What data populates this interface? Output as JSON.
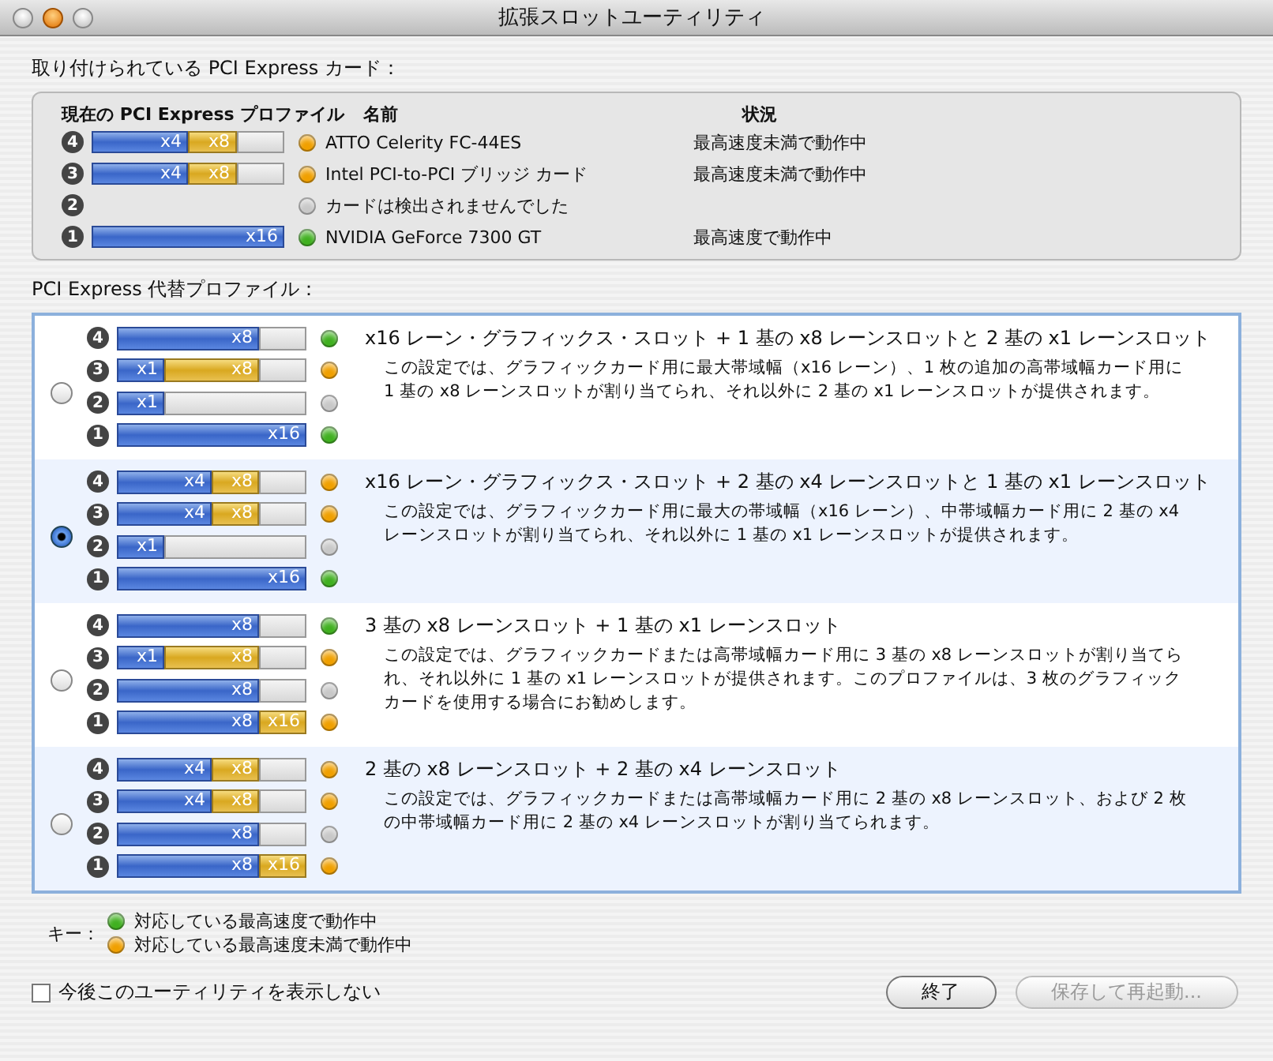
{
  "window": {
    "title": "拡張スロットユーティリティ"
  },
  "installed": {
    "heading": "取り付けられている PCI Express カード：",
    "columns": [
      "現在の PCI Express プロファイル",
      "名前",
      "状況"
    ],
    "rows": [
      {
        "slot": "4",
        "segments": [
          {
            "kind": "link_half",
            "label": "x4"
          },
          {
            "kind": "card_quarter",
            "label": "x8"
          },
          {
            "kind": "spare_quarter"
          }
        ],
        "color": "#f0a000",
        "name": "ATTO Celerity FC-44ES",
        "status": "最高速度未満で動作中"
      },
      {
        "slot": "3",
        "segments": [
          {
            "kind": "link_half",
            "label": "x4"
          },
          {
            "kind": "card_quarter",
            "label": "x8"
          },
          {
            "kind": "spare_quarter"
          }
        ],
        "color": "#f0a000",
        "name": "Intel PCI-to-PCI ブリッジ カード",
        "status": "最高速度未満で動作中"
      },
      {
        "slot": "2",
        "segments": [],
        "color": "#c8c8c8",
        "name": "カードは検出されませんでした"
      },
      {
        "slot": "1",
        "segments": [
          {
            "kind": "link_whole",
            "label": "x16"
          }
        ],
        "color": "#40b020",
        "name": "NVIDIA GeForce 7300 GT",
        "status": "最高速度で動作中"
      }
    ]
  },
  "profiles": {
    "heading": "PCI Express 代替プロファイル：",
    "items": [
      {
        "selected": false,
        "title": "x16 レーン・グラフィックス・スロット + 1 基の x8 レーンスロットと 2 基の x1 レーンスロット",
        "description": "この設定では、グラフィックカード用に最大帯域幅（x16 レーン）、1 枚の追加の高帯域幅カード用に 1 基の x8 レーンスロットが割り当てられ、それ以外に 2 基の x1 レーンスロットが提供されます。",
        "slots": [
          {
            "slot": "4",
            "segments": [
              {
                "kind": "link_three_quarters",
                "label": "x8"
              },
              {
                "kind": "spare_quarter"
              }
            ],
            "color": "#40b020"
          },
          {
            "slot": "3",
            "segments": [
              {
                "kind": "link_quarter",
                "label": "x1"
              },
              {
                "kind": "card_half",
                "label": "x8"
              },
              {
                "kind": "spare_quarter"
              }
            ],
            "color": "#f0a000"
          },
          {
            "slot": "2",
            "segments": [
              {
                "kind": "link_quarter",
                "label": "x1"
              },
              {
                "kind": "spare_three_quarters"
              }
            ],
            "color": "#c8c8c8"
          },
          {
            "slot": "1",
            "segments": [
              {
                "kind": "link_whole",
                "label": "x16"
              }
            ],
            "color": "#40b020"
          }
        ]
      },
      {
        "selected": true,
        "title": "x16 レーン・グラフィックス・スロット + 2 基の x4 レーンスロットと 1 基の x1 レーンスロット",
        "description": "この設定では、グラフィックカード用に最大の帯域幅（x16 レーン）、中帯域幅カード用に 2 基の x4 レーンスロットが割り当てられ、それ以外に 1 基の x1 レーンスロットが提供されます。",
        "slots": [
          {
            "slot": "4",
            "segments": [
              {
                "kind": "link_half",
                "label": "x4"
              },
              {
                "kind": "card_quarter",
                "label": "x8"
              },
              {
                "kind": "spare_quarter"
              }
            ],
            "color": "#f0a000"
          },
          {
            "slot": "3",
            "segments": [
              {
                "kind": "link_half",
                "label": "x4"
              },
              {
                "kind": "card_quarter",
                "label": "x8"
              },
              {
                "kind": "spare_quarter"
              }
            ],
            "color": "#f0a000"
          },
          {
            "slot": "2",
            "segments": [
              {
                "kind": "link_quarter",
                "label": "x1"
              },
              {
                "kind": "spare_three_quarters"
              }
            ],
            "color": "#c8c8c8"
          },
          {
            "slot": "1",
            "segments": [
              {
                "kind": "link_whole",
                "label": "x16"
              }
            ],
            "color": "#40b020"
          }
        ]
      },
      {
        "selected": false,
        "title": "3 基の x8 レーンスロット + 1 基の x1 レーンスロット",
        "description": "この設定では、グラフィックカードまたは高帯域幅カード用に 3 基の x8 レーンスロットが割り当てられ、それ以外に 1 基の x1 レーンスロットが提供されます。このプロファイルは、3 枚のグラフィックカードを使用する場合にお勧めします。",
        "slots": [
          {
            "slot": "4",
            "segments": [
              {
                "kind": "link_three_quarters",
                "label": "x8"
              },
              {
                "kind": "spare_quarter"
              }
            ],
            "color": "#40b020"
          },
          {
            "slot": "3",
            "segments": [
              {
                "kind": "link_quarter",
                "label": "x1"
              },
              {
                "kind": "card_half",
                "label": "x8"
              },
              {
                "kind": "spare_quarter"
              }
            ],
            "color": "#f0a000"
          },
          {
            "slot": "2",
            "segments": [
              {
                "kind": "link_three_quarters",
                "label": "x8"
              },
              {
                "kind": "spare_quarter"
              }
            ],
            "color": "#c8c8c8"
          },
          {
            "slot": "1",
            "segments": [
              {
                "kind": "link_three_quarters",
                "label": "x8"
              },
              {
                "kind": "card_quarter",
                "label": "x16"
              }
            ],
            "color": "#f0a000"
          }
        ]
      },
      {
        "selected": false,
        "title": "2 基の x8 レーンスロット + 2 基の x4 レーンスロット",
        "description": "この設定では、グラフィックカードまたは高帯域幅カード用に 2 基の x8 レーンスロット、および 2 枚の中帯域幅カード用に 2 基の x4 レーンスロットが割り当てられます。",
        "slots": [
          {
            "slot": "4",
            "segments": [
              {
                "kind": "link_half",
                "label": "x4"
              },
              {
                "kind": "card_quarter",
                "label": "x8"
              },
              {
                "kind": "spare_quarter"
              }
            ],
            "color": "#f0a000"
          },
          {
            "slot": "3",
            "segments": [
              {
                "kind": "link_half",
                "label": "x4"
              },
              {
                "kind": "card_quarter",
                "label": "x8"
              },
              {
                "kind": "spare_quarter"
              }
            ],
            "color": "#f0a000"
          },
          {
            "slot": "2",
            "segments": [
              {
                "kind": "link_three_quarters",
                "label": "x8"
              },
              {
                "kind": "spare_quarter"
              }
            ],
            "color": "#c8c8c8"
          },
          {
            "slot": "1",
            "segments": [
              {
                "kind": "link_three_quarters",
                "label": "x8"
              },
              {
                "kind": "card_quarter",
                "label": "x16"
              }
            ],
            "color": "#f0a000"
          }
        ]
      }
    ]
  },
  "key": {
    "label": "キー：",
    "entries": [
      {
        "color": "#40b020",
        "text": "対応している最高速度で動作中"
      },
      {
        "color": "#f0a000",
        "text": "対応している最高速度未満で動作中"
      }
    ]
  },
  "dont_show": {
    "label": "今後このユーティリティを表示しない",
    "checked": false
  },
  "buttons": [
    {
      "label": "終了",
      "disabled": false
    },
    {
      "label": "保存して再起動...",
      "disabled": true
    }
  ]
}
